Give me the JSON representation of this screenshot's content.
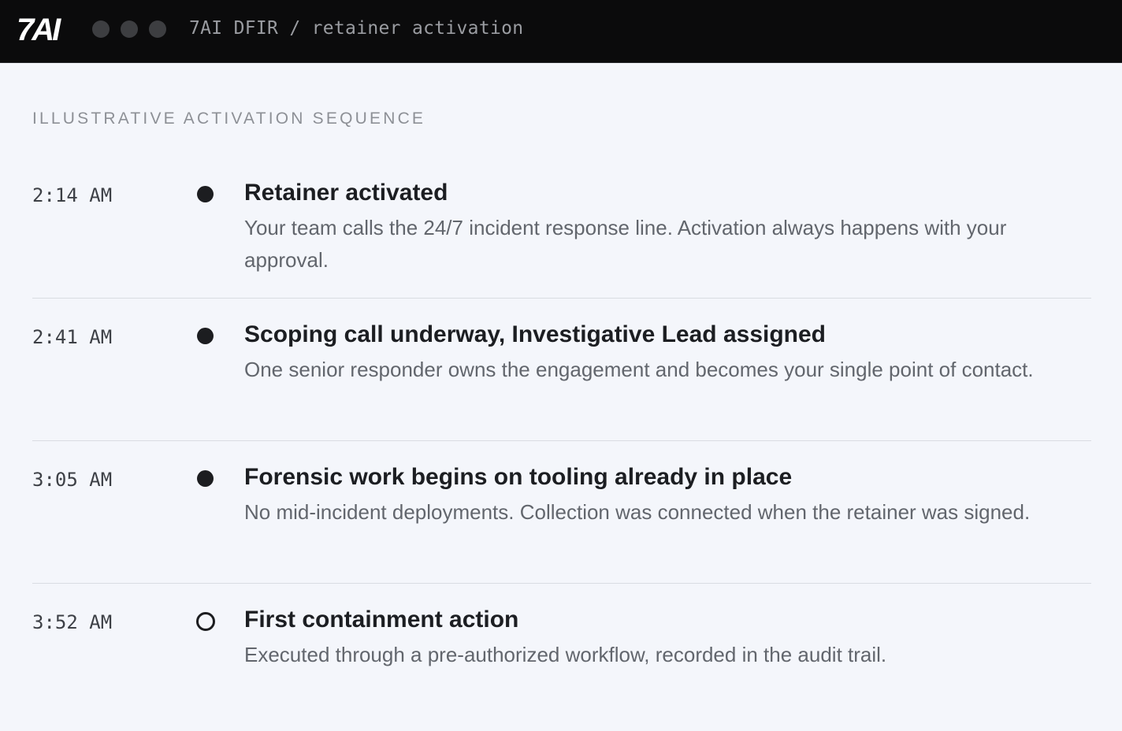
{
  "window": {
    "logo_text": "7AI",
    "path": "7AI DFIR / retainer activation"
  },
  "section": {
    "label": "ILLUSTRATIVE ACTIVATION SEQUENCE"
  },
  "events": [
    {
      "time": "2:14 AM",
      "marker": "filled",
      "title": "Retainer activated",
      "description": "Your team calls the 24/7 incident response line. Activation always happens with your approval."
    },
    {
      "time": "2:41 AM",
      "marker": "filled",
      "title": "Scoping call underway, Investigative Lead assigned",
      "description": "One senior responder owns the engagement and becomes your single point of contact."
    },
    {
      "time": "3:05 AM",
      "marker": "filled",
      "title": "Forensic work begins on tooling already in place",
      "description": "No mid-incident deployments. Collection was connected when the retainer was signed."
    },
    {
      "time": "3:52 AM",
      "marker": "open",
      "title": "First containment action",
      "description": "Executed through a pre-authorized workflow, recorded in the audit trail."
    }
  ],
  "colors": {
    "titlebar": "#0b0b0c",
    "background": "#f4f6fb",
    "marker": "#1c1d20",
    "divider": "#d9dce2"
  }
}
